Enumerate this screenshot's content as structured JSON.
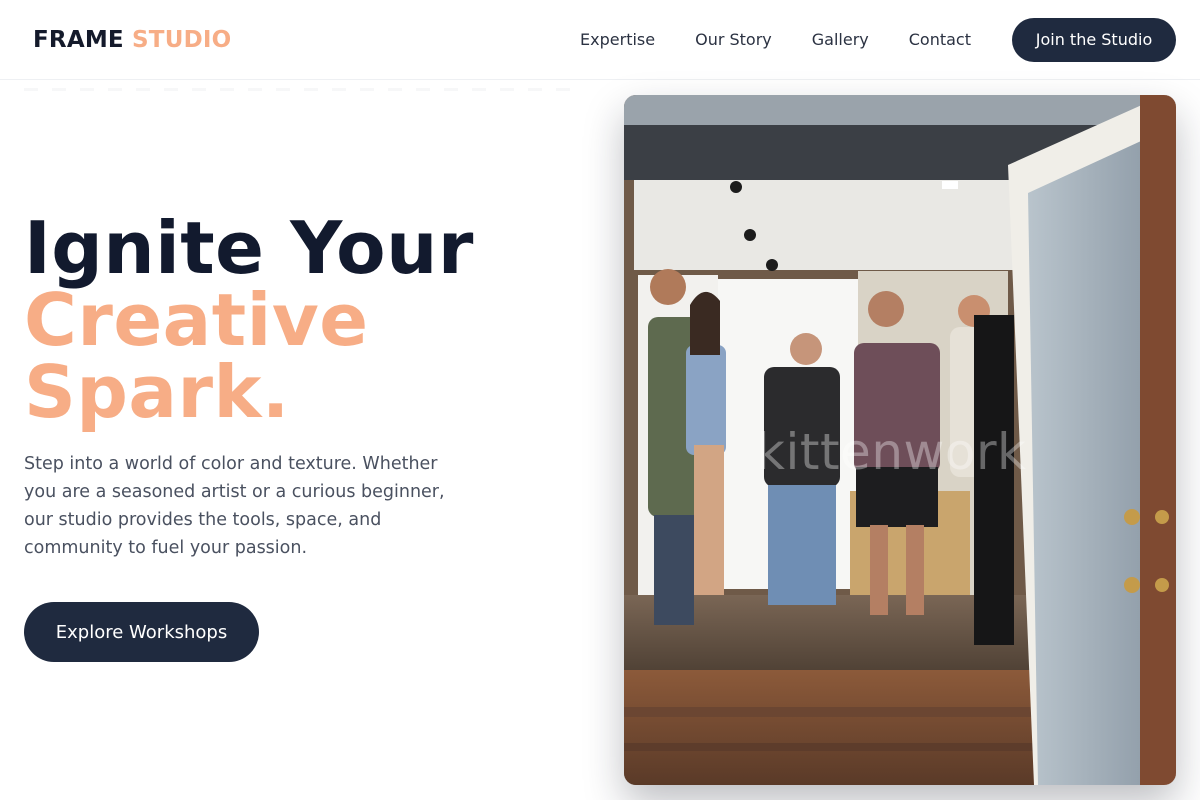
{
  "brand": {
    "part1": "FRAME",
    "part2": "STUDIO"
  },
  "nav": {
    "links": [
      "Expertise",
      "Our Story",
      "Gallery",
      "Contact"
    ],
    "cta": "Join the Studio"
  },
  "hero": {
    "line1": "Ignite Your",
    "line2": "Creative",
    "line3": "Spark.",
    "description": "Step into a world of color and texture. Whether you are a seasoned artist or a curious beginner, our studio provides the tools, space, and community to fuel your passion.",
    "button": "Explore Workshops"
  },
  "photo": {
    "watermark": "kittenwork"
  },
  "colors": {
    "accent": "#f7ad86",
    "dark": "#1f2a3f",
    "heading": "#121a2e",
    "body_text": "#4a5160"
  }
}
